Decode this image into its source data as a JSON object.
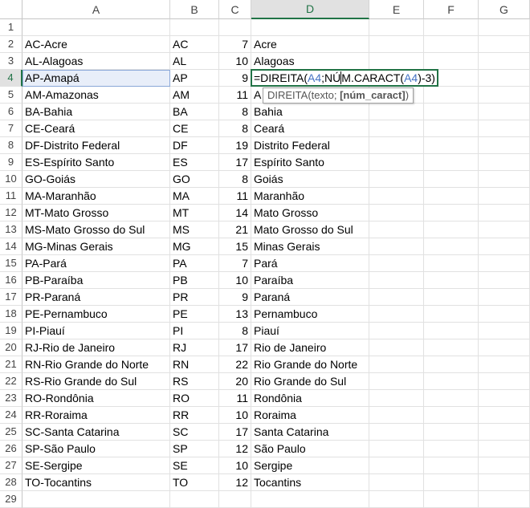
{
  "columns": [
    "A",
    "B",
    "C",
    "D",
    "E",
    "F",
    "G"
  ],
  "row_numbers": [
    1,
    2,
    3,
    4,
    5,
    6,
    7,
    8,
    9,
    10,
    11,
    12,
    13,
    14,
    15,
    16,
    17,
    18,
    19,
    20,
    21,
    22,
    23,
    24,
    25,
    26,
    27,
    28,
    29
  ],
  "rows": [
    {
      "a": "",
      "b": "",
      "c": "",
      "d": ""
    },
    {
      "a": "AC-Acre",
      "b": "AC",
      "c": "7",
      "d": "Acre"
    },
    {
      "a": "AL-Alagoas",
      "b": "AL",
      "c": "10",
      "d": "Alagoas"
    },
    {
      "a": "AP-Amapá",
      "b": "AP",
      "c": "9",
      "d": ""
    },
    {
      "a": "AM-Amazonas",
      "b": "AM",
      "c": "11",
      "d": "A"
    },
    {
      "a": "BA-Bahia",
      "b": "BA",
      "c": "8",
      "d": "Bahia"
    },
    {
      "a": "CE-Ceará",
      "b": "CE",
      "c": "8",
      "d": "Ceará"
    },
    {
      "a": "DF-Distrito Federal",
      "b": "DF",
      "c": "19",
      "d": "Distrito Federal"
    },
    {
      "a": "ES-Espírito Santo",
      "b": "ES",
      "c": "17",
      "d": "Espírito Santo"
    },
    {
      "a": "GO-Goiás",
      "b": "GO",
      "c": "8",
      "d": "Goiás"
    },
    {
      "a": "MA-Maranhão",
      "b": "MA",
      "c": "11",
      "d": "Maranhão"
    },
    {
      "a": "MT-Mato Grosso",
      "b": "MT",
      "c": "14",
      "d": "Mato Grosso"
    },
    {
      "a": "MS-Mato Grosso do Sul",
      "b": "MS",
      "c": "21",
      "d": "Mato Grosso do Sul"
    },
    {
      "a": "MG-Minas Gerais",
      "b": "MG",
      "c": "15",
      "d": "Minas Gerais"
    },
    {
      "a": "PA-Pará",
      "b": "PA",
      "c": "7",
      "d": "Pará"
    },
    {
      "a": "PB-Paraíba",
      "b": "PB",
      "c": "10",
      "d": "Paraíba"
    },
    {
      "a": "PR-Paraná",
      "b": "PR",
      "c": "9",
      "d": "Paraná"
    },
    {
      "a": "PE-Pernambuco",
      "b": "PE",
      "c": "13",
      "d": "Pernambuco"
    },
    {
      "a": "PI-Piauí",
      "b": "PI",
      "c": "8",
      "d": "Piauí"
    },
    {
      "a": "RJ-Rio de Janeiro",
      "b": "RJ",
      "c": "17",
      "d": "Rio de Janeiro"
    },
    {
      "a": "RN-Rio Grande do Norte",
      "b": "RN",
      "c": "22",
      "d": "Rio Grande do Norte"
    },
    {
      "a": "RS-Rio Grande do Sul",
      "b": "RS",
      "c": "20",
      "d": "Rio Grande do Sul"
    },
    {
      "a": "RO-Rondônia",
      "b": "RO",
      "c": "11",
      "d": "Rondônia"
    },
    {
      "a": "RR-Roraima",
      "b": "RR",
      "c": "10",
      "d": "Roraima"
    },
    {
      "a": "SC-Santa Catarina",
      "b": "SC",
      "c": "17",
      "d": "Santa Catarina"
    },
    {
      "a": "SP-São Paulo",
      "b": "SP",
      "c": "12",
      "d": "São Paulo"
    },
    {
      "a": "SE-Sergipe",
      "b": "SE",
      "c": "10",
      "d": "Sergipe"
    },
    {
      "a": "TO-Tocantins",
      "b": "TO",
      "c": "12",
      "d": "Tocantins"
    },
    {
      "a": "",
      "b": "",
      "c": "",
      "d": ""
    }
  ],
  "active_cell": {
    "column": "D",
    "row": 4
  },
  "formula": {
    "prefix": "=DIREITA(",
    "ref1": "A4",
    "mid1": ";NÚ",
    "mid2": "M.CARACT(",
    "ref2": "A4",
    "suffix": ")-3)"
  },
  "tooltip": {
    "func": "DIREITA(texto; ",
    "arg": "[núm_caract]",
    "close": ")"
  },
  "colors": {
    "selection_green": "#217346",
    "reference_blue": "#4472c4",
    "gridline": "#e1e1e1",
    "header_selected_bg": "#e1e1e1"
  }
}
